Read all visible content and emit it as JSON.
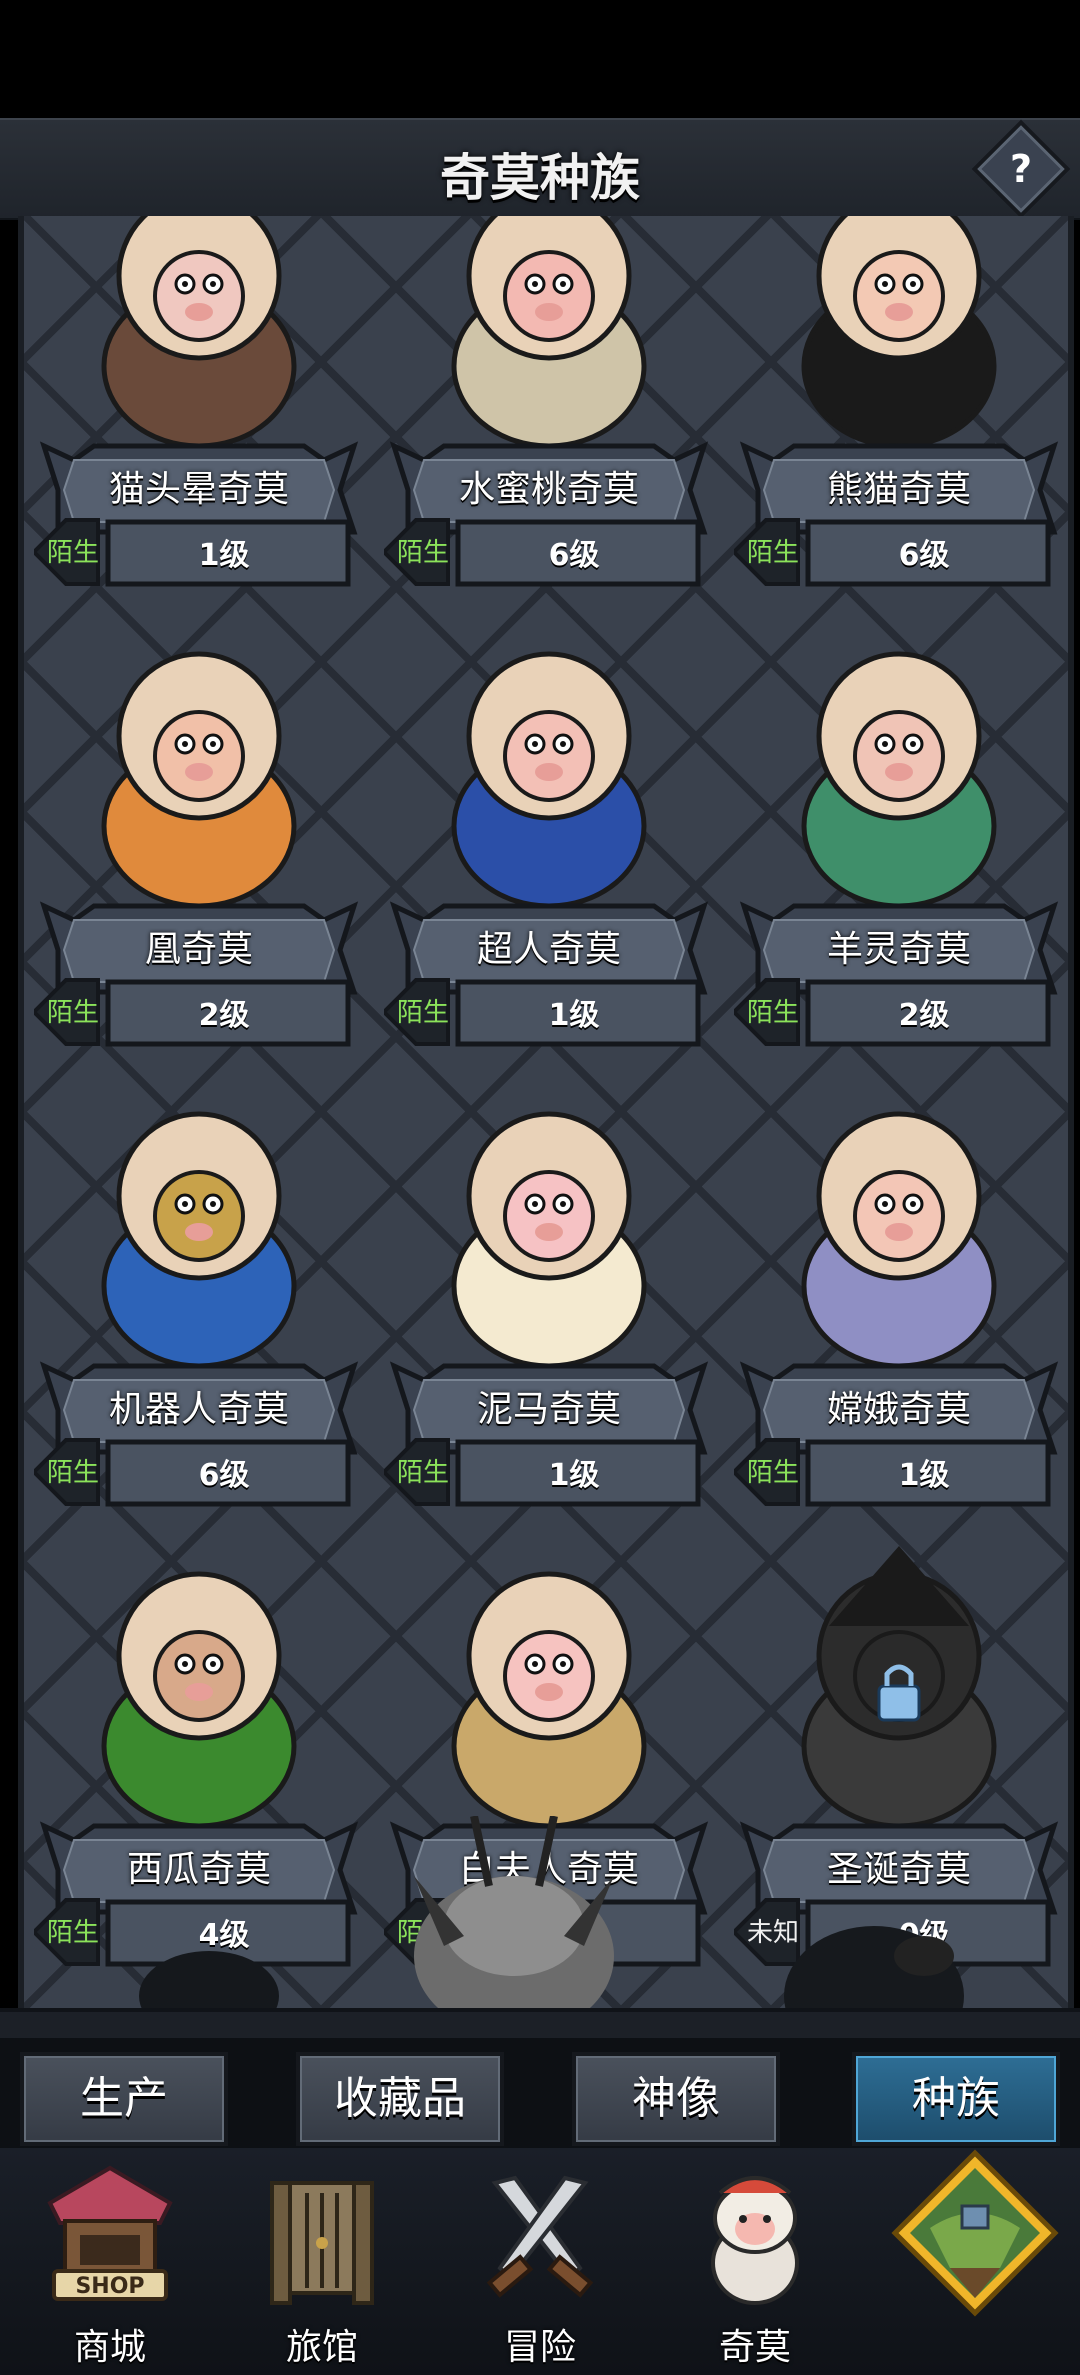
{
  "header": {
    "title": "奇莫种族",
    "help_label": "?"
  },
  "cards": [
    {
      "name": "猫头晕奇莫",
      "status": "陌生",
      "level": "1级",
      "art": "owl-kimo",
      "skin": "#f0c8c0",
      "accent": "#6a4a3a"
    },
    {
      "name": "水蜜桃奇莫",
      "status": "陌生",
      "level": "6级",
      "art": "peach-kimo",
      "skin": "#f3b9b2",
      "accent": "#cfc4a8"
    },
    {
      "name": "熊猫奇莫",
      "status": "陌生",
      "level": "6级",
      "art": "panda-kimo",
      "skin": "#f3c9b4",
      "accent": "#1a1a1a"
    },
    {
      "name": "凰奇莫",
      "status": "陌生",
      "level": "2级",
      "art": "phoenix-kimo",
      "skin": "#f1c0a8",
      "accent": "#e08a3c"
    },
    {
      "name": "超人奇莫",
      "status": "陌生",
      "level": "1级",
      "art": "captain-kimo",
      "skin": "#f3c0b6",
      "accent": "#2b4fa8"
    },
    {
      "name": "羊灵奇莫",
      "status": "陌生",
      "level": "2级",
      "art": "ram-skull-kimo",
      "skin": "#f0c4b6",
      "accent": "#3f8f6a"
    },
    {
      "name": "机器人奇莫",
      "status": "陌生",
      "level": "6级",
      "art": "robot-kimo",
      "skin": "#c8a24a",
      "accent": "#2d63b8"
    },
    {
      "name": "泥马奇莫",
      "status": "陌生",
      "level": "1级",
      "art": "alpaca-kimo",
      "skin": "#f6c2c4",
      "accent": "#f4ead0"
    },
    {
      "name": "嫦娥奇莫",
      "status": "陌生",
      "level": "1级",
      "art": "chang-e-kimo",
      "skin": "#f3c6b6",
      "accent": "#8f8fc4"
    },
    {
      "name": "西瓜奇莫",
      "status": "陌生",
      "level": "4级",
      "art": "watermelon-kimo",
      "skin": "#d8a98a",
      "accent": "#3b8a2e"
    },
    {
      "name": "白夫人奇莫",
      "status": "陌生",
      "level": "1级",
      "art": "lady-white-kimo",
      "skin": "#f6c3c0",
      "accent": "#c9a86a"
    },
    {
      "name": "圣诞奇莫",
      "status": "未知",
      "level": "0级",
      "art": "locked-christmas-kimo",
      "skin": "#2a2a2a",
      "accent": "#3a3a3a"
    }
  ],
  "tabs": [
    {
      "label": "生产"
    },
    {
      "label": "收藏品"
    },
    {
      "label": "神像"
    },
    {
      "label": "种族"
    }
  ],
  "nav": [
    {
      "label": "商城",
      "icon": "shop-icon",
      "sign": "SHOP"
    },
    {
      "label": "旅馆",
      "icon": "inn-gate-icon"
    },
    {
      "label": "冒险",
      "icon": "crossed-swords-icon"
    },
    {
      "label": "奇莫",
      "icon": "kimo-character-icon"
    },
    {
      "label": "",
      "icon": "floating-island-icon"
    }
  ]
}
